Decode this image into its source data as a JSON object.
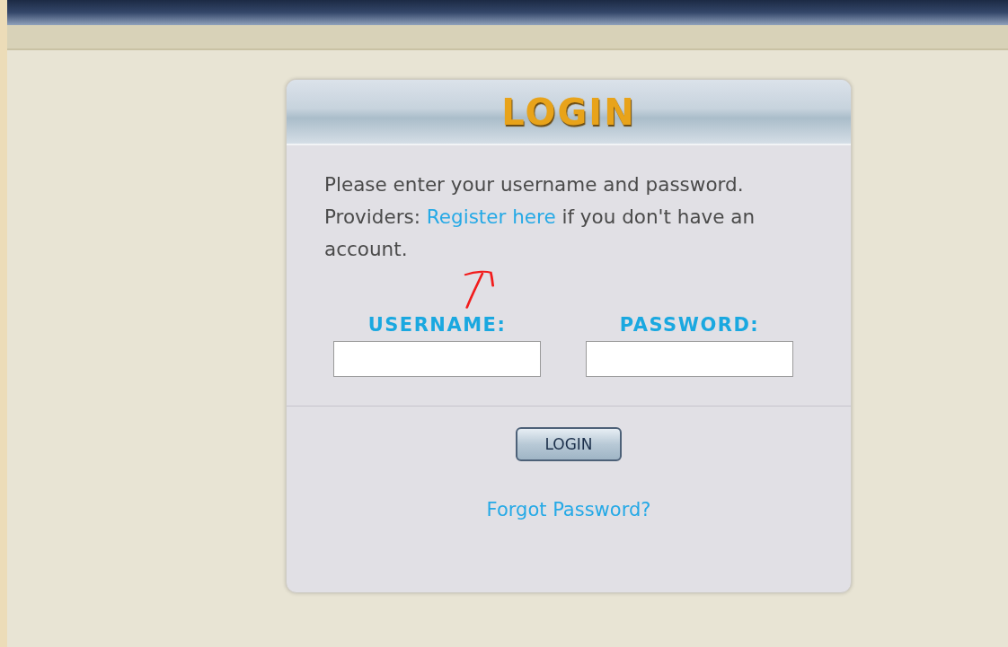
{
  "panel": {
    "title": "LOGIN",
    "intro": {
      "text_before": "Please enter your username and password. Providers:",
      "link": "Register here",
      "text_after": "if you don't have an account."
    },
    "fields": [
      {
        "label": "USERNAME:"
      },
      {
        "label": "PASSWORD:"
      }
    ],
    "button": "LOGIN",
    "forgot_link": "Forgot Password?"
  }
}
